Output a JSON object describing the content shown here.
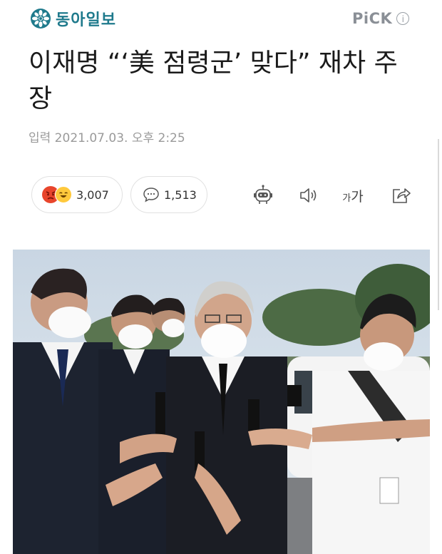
{
  "header": {
    "logo_text": "동아일보",
    "logo_icon": "donga-emblem-icon",
    "pick_label": "PiCK",
    "info_icon_glyph": "i",
    "brand_color": "#1f7a8c"
  },
  "article": {
    "headline": "이재명 “‘美 점령군’ 맞다” 재차 주장",
    "date": "입력 2021.07.03. 오후 2:25"
  },
  "reactions": {
    "count": "3,007",
    "icons": [
      "angry-face-icon",
      "laughing-face-icon"
    ]
  },
  "comments": {
    "count": "1,513",
    "icon": "speech-bubble-icon"
  },
  "toolbar": {
    "font_label_small": "가",
    "font_label_large": "가",
    "icons": [
      "robot-summary-icon",
      "speaker-icon",
      "font-size-icon",
      "share-icon"
    ]
  },
  "photo": {
    "description_icon": "news-photo"
  }
}
